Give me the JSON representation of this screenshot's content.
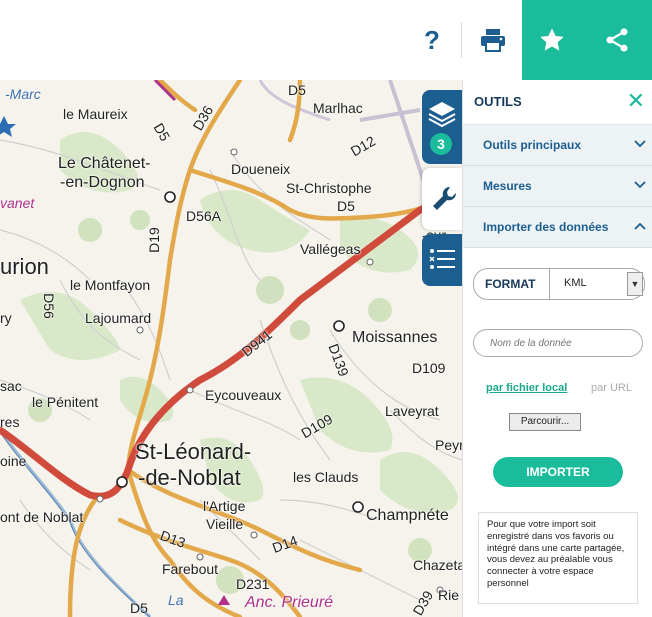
{
  "header": {
    "help_label": "?",
    "print_icon": "printer-icon",
    "favorite_icon": "star-icon",
    "share_icon": "share-icon",
    "accent_color": "#1abc9c"
  },
  "map": {
    "places": [
      {
        "label": "-Marc"
      },
      {
        "label": "le Maureix"
      },
      {
        "label": "Marlhac"
      },
      {
        "label": "Le Châtenet-"
      },
      {
        "label": "-en-Dognon"
      },
      {
        "label": "Doueneix"
      },
      {
        "label": "St-Christophe"
      },
      {
        "label": "vanet"
      },
      {
        "label": "urion"
      },
      {
        "label": "le Montfayon"
      },
      {
        "label": "Vallégeas"
      },
      {
        "label": "Lajoumard"
      },
      {
        "label": "Moissannes"
      },
      {
        "label": "le Pénitent"
      },
      {
        "label": "Eycouveaux"
      },
      {
        "label": "Laveyrat"
      },
      {
        "label": "St-Léonard-"
      },
      {
        "label": "-de-Noblat"
      },
      {
        "label": "les Clauds"
      },
      {
        "label": "Peyr"
      },
      {
        "label": "Champnéte"
      },
      {
        "label": "l'Artige"
      },
      {
        "label": "Vieille"
      },
      {
        "label": "Farebout"
      },
      {
        "label": "Chazeta"
      },
      {
        "label": "Anc. Prieuré"
      },
      {
        "label": "ont de Noblat"
      },
      {
        "label": "res"
      },
      {
        "label": "sac"
      },
      {
        "label": "oine"
      },
      {
        "label": "-sur"
      },
      {
        "label": "Rie"
      },
      {
        "label": "ry"
      },
      {
        "label": "La"
      }
    ],
    "roads": [
      "D5",
      "D36",
      "D5",
      "D12",
      "D5",
      "D56A",
      "D19",
      "D56",
      "D941",
      "D139",
      "D109",
      "D109",
      "D13",
      "D14",
      "D231",
      "D39",
      "D5"
    ]
  },
  "side_tabs": {
    "layers_icon": "layers-icon",
    "layers_count": "3",
    "tools_icon": "wrench-icon",
    "legend_icon": "legend-list-icon"
  },
  "panel": {
    "title": "OUTILS",
    "close_icon": "close-icon",
    "sections": [
      {
        "label": "Outils principaux"
      },
      {
        "label": "Mesures"
      },
      {
        "label": "Importer des données"
      }
    ],
    "format_label": "FORMAT",
    "format_value": "KML",
    "name_placeholder": "Nom de la donnée",
    "source_local": "par fichier local",
    "source_url": "par URL",
    "browse_label": "Parcourir...",
    "import_label": "IMPORTER",
    "note": "Pour que votre import soit enregistré dans vos favoris ou intégré dans une carte partagée, vous devez au préalable vous connecter à votre espace personnel"
  }
}
